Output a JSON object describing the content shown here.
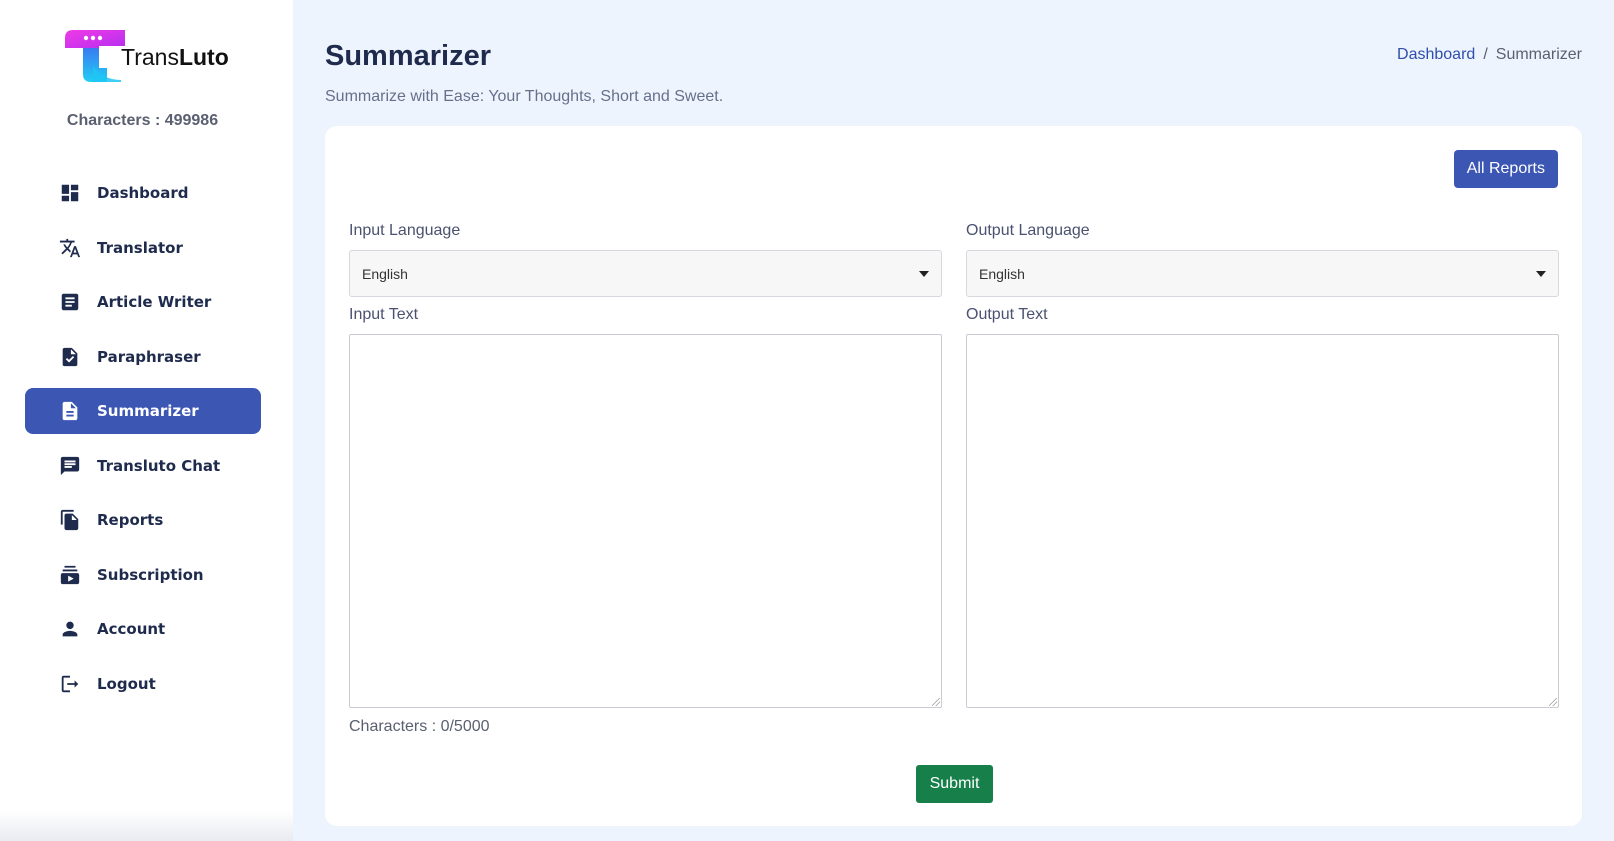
{
  "brand": {
    "name_regular": "Trans",
    "name_bold": "Luto"
  },
  "sidebar": {
    "characters": "Characters : 499986",
    "items": [
      {
        "label": "Dashboard",
        "icon": "dashboard-icon"
      },
      {
        "label": "Translator",
        "icon": "translate-icon"
      },
      {
        "label": "Article Writer",
        "icon": "article-icon"
      },
      {
        "label": "Paraphraser",
        "icon": "document-check-icon"
      },
      {
        "label": "Summarizer",
        "icon": "description-icon",
        "active": true
      },
      {
        "label": "Transluto Chat",
        "icon": "chat-icon"
      },
      {
        "label": "Reports",
        "icon": "file-copy-icon"
      },
      {
        "label": "Subscription",
        "icon": "subscriptions-icon"
      },
      {
        "label": "Account",
        "icon": "person-icon"
      },
      {
        "label": "Logout",
        "icon": "logout-icon"
      }
    ]
  },
  "header": {
    "title": "Summarizer",
    "subtitle": "Summarize with Ease: Your Thoughts, Short and Sweet.",
    "breadcrumb": {
      "link": "Dashboard",
      "separator": "/",
      "current": "Summarizer"
    }
  },
  "form": {
    "all_reports_label": "All Reports",
    "input_language_label": "Input Language",
    "input_language_value": "English",
    "output_language_label": "Output Language",
    "output_language_value": "English",
    "input_text_label": "Input Text",
    "output_text_label": "Output Text",
    "char_counter": "Characters : 0/5000",
    "submit_label": "Submit"
  },
  "colors": {
    "accent": "#3b56b3",
    "submit": "#17804a",
    "background": "#eef4fd",
    "logo_magenta": "#e62ee8",
    "logo_cyan": "#1fb7f0"
  }
}
